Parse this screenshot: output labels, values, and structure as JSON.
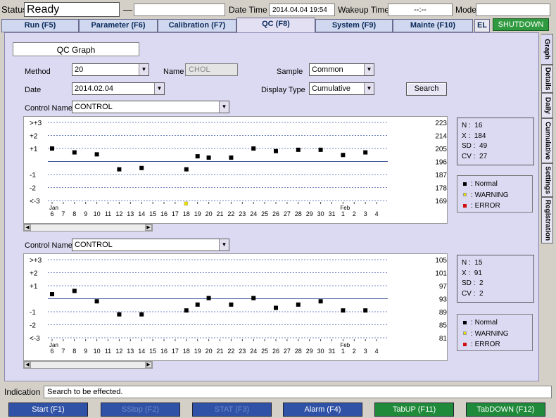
{
  "status": {
    "label": "Status",
    "value": "Ready"
  },
  "header": {
    "dash": "—",
    "datetime_label": "Date Time",
    "datetime_value": "2014.04.04  19:54",
    "wakeup_label": "Wakeup Time",
    "wakeup_value": "--:--",
    "mode_label": "Mode",
    "mode_value": ""
  },
  "tabs": [
    {
      "label": "Run (F5)"
    },
    {
      "label": "Parameter (F6)"
    },
    {
      "label": "Calibration (F7)"
    },
    {
      "label": "QC (F8)"
    },
    {
      "label": "System (F9)"
    },
    {
      "label": "Mainte (F10)"
    }
  ],
  "el_label": "EL",
  "shutdown_label": "SHUTDOWN",
  "panel_title": "QC Graph",
  "form": {
    "method_label": "Method",
    "method_value": "20",
    "name_label": "Name",
    "name_value": "CHOL",
    "sample_label": "Sample",
    "sample_value": "Common",
    "date_label": "Date",
    "date_value": "2014.02.04",
    "display_type_label": "Display Type",
    "display_type_value": "Cumulative",
    "search_label": "Search",
    "control_name_label": "Control Name",
    "control_name_value": "CONTROL"
  },
  "side_tabs": [
    {
      "label": "Graph"
    },
    {
      "label": "Details"
    },
    {
      "label": "Daily"
    },
    {
      "label": "Cumulative"
    },
    {
      "label": "Settings"
    },
    {
      "label": "Registration"
    }
  ],
  "legend": {
    "normal": "Normal",
    "warning": "WARNING",
    "error": "ERROR",
    "colors": {
      "normal": "#000000",
      "warning": "#e8e000",
      "error": "#d01010"
    }
  },
  "chart_data": [
    {
      "type": "scatter",
      "control_label": "Control Name",
      "control_name": "CONTROL",
      "ylabels_left": [
        ">+3",
        "+2",
        "+1",
        "",
        "-1",
        "-2",
        "<-3"
      ],
      "ylabels_right": [
        "223",
        "214",
        "205",
        "196",
        "187",
        "178",
        "169"
      ],
      "xticks": [
        "6",
        "7",
        "8",
        "9",
        "10",
        "11",
        "12",
        "13",
        "14",
        "15",
        "16",
        "17",
        "18",
        "19",
        "20",
        "21",
        "22",
        "23",
        "24",
        "25",
        "26",
        "27",
        "28",
        "29",
        "30",
        "31",
        "1",
        "2",
        "3",
        "4"
      ],
      "month_labels": [
        {
          "text": "Jan",
          "index": 0
        },
        {
          "text": "Feb",
          "index": 26
        }
      ],
      "points": [
        {
          "x": "6",
          "y": 1.0
        },
        {
          "x": "8",
          "y": 0.7
        },
        {
          "x": "10",
          "y": 0.55
        },
        {
          "x": "12",
          "y": -0.6
        },
        {
          "x": "14",
          "y": -0.5
        },
        {
          "x": "18",
          "y": -0.6
        },
        {
          "x": "19",
          "y": 0.4
        },
        {
          "x": "20",
          "y": 0.3
        },
        {
          "x": "22",
          "y": 0.3
        },
        {
          "x": "24",
          "y": 1.0
        },
        {
          "x": "26",
          "y": 0.8
        },
        {
          "x": "28",
          "y": 0.9
        },
        {
          "x": "30",
          "y": 0.9
        },
        {
          "x": "1",
          "y": 0.5
        },
        {
          "x": "3",
          "y": 0.7
        }
      ],
      "warning_points": [
        {
          "x": "18",
          "y": -3.2
        }
      ],
      "stats": {
        "n_label": "N",
        "n": "16",
        "x_label": "X",
        "x": "184",
        "sd_label": "SD",
        "sd": "49",
        "cv_label": "CV",
        "cv": "27"
      }
    },
    {
      "type": "scatter",
      "control_label": "Control Name",
      "control_name": "CONTROL",
      "ylabels_left": [
        ">+3",
        "+2",
        "+1",
        "",
        "-1",
        "-2",
        "<-3"
      ],
      "ylabels_right": [
        "105",
        "101",
        "97",
        "93",
        "89",
        "85",
        "81"
      ],
      "xticks": [
        "6",
        "7",
        "8",
        "9",
        "10",
        "11",
        "12",
        "13",
        "14",
        "15",
        "16",
        "17",
        "18",
        "19",
        "20",
        "21",
        "22",
        "23",
        "24",
        "25",
        "26",
        "27",
        "28",
        "29",
        "30",
        "31",
        "1",
        "2",
        "3",
        "4"
      ],
      "month_labels": [
        {
          "text": "Jan",
          "index": 0
        },
        {
          "text": "Feb",
          "index": 26
        }
      ],
      "points": [
        {
          "x": "6",
          "y": 0.35
        },
        {
          "x": "8",
          "y": 0.6
        },
        {
          "x": "10",
          "y": -0.2
        },
        {
          "x": "12",
          "y": -1.2
        },
        {
          "x": "14",
          "y": -1.2
        },
        {
          "x": "18",
          "y": -0.9
        },
        {
          "x": "19",
          "y": -0.45
        },
        {
          "x": "20",
          "y": 0.05
        },
        {
          "x": "22",
          "y": -0.45
        },
        {
          "x": "24",
          "y": 0.05
        },
        {
          "x": "26",
          "y": -0.7
        },
        {
          "x": "28",
          "y": -0.45
        },
        {
          "x": "30",
          "y": -0.2
        },
        {
          "x": "1",
          "y": -0.9
        },
        {
          "x": "3",
          "y": -0.9
        }
      ],
      "warning_points": [],
      "stats": {
        "n_label": "N",
        "n": "15",
        "x_label": "X",
        "x": "91",
        "sd_label": "SD",
        "sd": "2",
        "cv_label": "CV",
        "cv": "2"
      }
    }
  ],
  "indication": {
    "label": "Indication",
    "value": "Search to be effected."
  },
  "footer_buttons": [
    {
      "label": "Start (F1)"
    },
    {
      "label": "SStop (F2)"
    },
    {
      "label": "STAT (F3)"
    },
    {
      "label": "Alarm (F4)"
    },
    {
      "label": "TabUP (F11)"
    },
    {
      "label": "TabDOWN (F12)"
    }
  ]
}
